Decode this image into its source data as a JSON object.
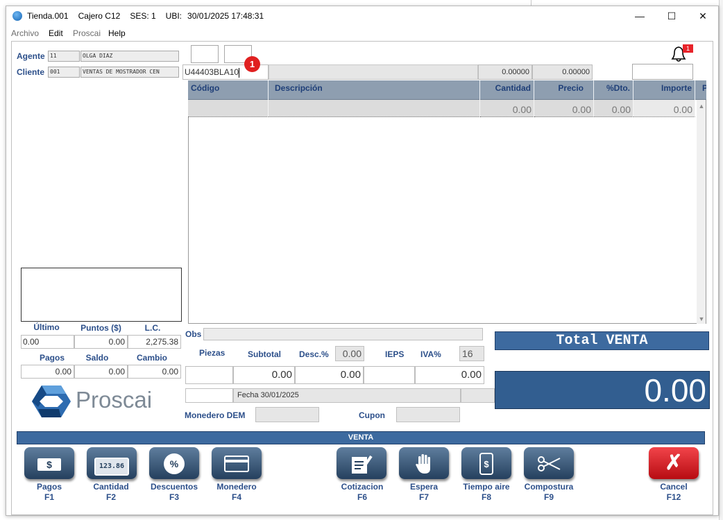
{
  "window": {
    "title_parts": [
      "Tienda.001",
      "Cajero C12",
      "SES: 1",
      "UBI:",
      "30/01/2025 17:48:31"
    ],
    "controls": {
      "minimize": "—",
      "maximize": "☐",
      "close": "✕"
    }
  },
  "menu": [
    "Archivo",
    "Edit",
    "Proscai",
    "Help"
  ],
  "agent": {
    "label": "Agente",
    "code": "11",
    "name": "OLGA DIAZ"
  },
  "client": {
    "label": "Cliente",
    "code": "001",
    "name": "VENTAS DE MOSTRADOR CEN"
  },
  "notification": {
    "count": "1"
  },
  "entry": {
    "code": "U44403BLA10",
    "badge": "1",
    "qty": "0.00000",
    "price": "0.00000"
  },
  "grid": {
    "columns": [
      "Código",
      "Descripción",
      "Cantidad",
      "Precio",
      "%Dto.",
      "Importe",
      "P"
    ],
    "row": {
      "cantidad": "0.00",
      "precio": "0.00",
      "dto": "0.00",
      "importe": "0.00"
    }
  },
  "stats": {
    "labels": {
      "ultimo": "Último",
      "puntos": "Puntos ($)",
      "lc": "L.C."
    },
    "values": {
      "ultimo": "0.00",
      "puntos": "0.00",
      "lc": "2,275.38"
    },
    "labels2": {
      "pagos": "Pagos",
      "saldo": "Saldo",
      "cambio": "Cambio"
    },
    "values2": {
      "pagos": "0.00",
      "saldo": "0.00",
      "cambio": "0.00"
    }
  },
  "brand": {
    "name": "Proscai"
  },
  "obs": {
    "label": "Obs"
  },
  "totals": {
    "labels": {
      "piezas": "Piezas",
      "subtotal": "Subtotal",
      "desc": "Desc.%",
      "ieps": "IEPS",
      "iva": "IVA%"
    },
    "desc_pct": "0.00",
    "iva_pct": "16",
    "subtotal": "0.00",
    "desc": "0.00",
    "iva_amount": "0.00"
  },
  "fecha": "Fecha 30/01/2025",
  "monedero": {
    "label": "Monedero DEM"
  },
  "cupon": {
    "label": "Cupon"
  },
  "total": {
    "label": "Total VENTA",
    "value": "0.00"
  },
  "mode": "VENTA",
  "fkeys": [
    {
      "label": "Pagos",
      "key": "F1"
    },
    {
      "label": "Cantidad",
      "key": "F2"
    },
    {
      "label": "Descuentos",
      "key": "F3"
    },
    {
      "label": "Monedero",
      "key": "F4"
    },
    {
      "label": "Cotizacion",
      "key": "F6"
    },
    {
      "label": "Espera",
      "key": "F7"
    },
    {
      "label": "Tiempo aire",
      "key": "F8"
    },
    {
      "label": "Compostura",
      "key": "F9"
    },
    {
      "label": "Cancel",
      "key": "F12"
    }
  ],
  "fkey_glyphs": {
    "pagos": "$",
    "cantidad": "123.86",
    "descuentos": "%",
    "cancel": "✗"
  },
  "colors": {
    "accent": "#3d6a9f",
    "header": "#8e9eb0",
    "cancel": "#e8232a",
    "label": "#2c4f8a"
  }
}
